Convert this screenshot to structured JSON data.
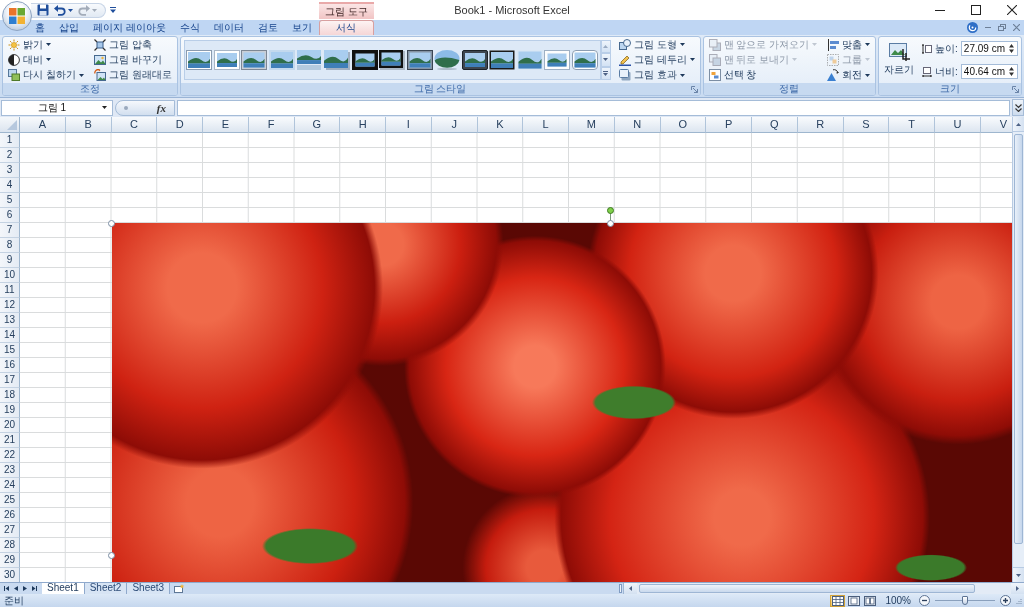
{
  "window": {
    "title": "Book1 - Microsoft Excel",
    "contextual_group": "그림 도구"
  },
  "quick_access": [
    {
      "kind": "save",
      "disabled": false,
      "dropdown": false
    },
    {
      "kind": "undo",
      "disabled": false,
      "dropdown": true
    },
    {
      "kind": "redo",
      "disabled": true,
      "dropdown": true
    }
  ],
  "tabs": [
    {
      "label": "홈",
      "selected": false,
      "contextual": false
    },
    {
      "label": "삽입",
      "selected": false,
      "contextual": false
    },
    {
      "label": "페이지 레이아웃",
      "selected": false,
      "contextual": false
    },
    {
      "label": "수식",
      "selected": false,
      "contextual": false
    },
    {
      "label": "데이터",
      "selected": false,
      "contextual": false
    },
    {
      "label": "검토",
      "selected": false,
      "contextual": false
    },
    {
      "label": "보기",
      "selected": false,
      "contextual": false
    },
    {
      "label": "서식",
      "selected": true,
      "contextual": true
    }
  ],
  "ribbon_groups": [
    {
      "kind": "adjust",
      "label": "조정",
      "launcher": false,
      "columns": [
        [
          {
            "label": "밝기",
            "dropdown": true,
            "disabled": false
          },
          {
            "label": "대비",
            "dropdown": true,
            "disabled": false
          },
          {
            "label": "다시 칠하기",
            "dropdown": true,
            "disabled": false
          }
        ],
        [
          {
            "label": "그림 압축",
            "dropdown": false,
            "disabled": false
          },
          {
            "label": "그림 바꾸기",
            "dropdown": false,
            "disabled": false
          },
          {
            "label": "그림 원래대로",
            "dropdown": false,
            "disabled": false
          }
        ]
      ]
    },
    {
      "kind": "styles",
      "label": "그림 스타일",
      "launcher": true,
      "columns": [
        [
          {
            "label": "그림 도형",
            "dropdown": true,
            "disabled": false
          },
          {
            "label": "그림 테두리",
            "dropdown": true,
            "disabled": false
          },
          {
            "label": "그림 효과",
            "dropdown": true,
            "disabled": false
          }
        ]
      ]
    },
    {
      "kind": "arrange",
      "label": "정렬",
      "launcher": false,
      "columns": [
        [
          {
            "label": "맨 앞으로 가져오기",
            "dropdown": true,
            "disabled": true
          },
          {
            "label": "맨 뒤로 보내기",
            "dropdown": true,
            "disabled": true
          },
          {
            "label": "선택 창",
            "dropdown": false,
            "disabled": false
          }
        ],
        [
          {
            "label": "맞춤",
            "dropdown": true,
            "disabled": false
          },
          {
            "label": "그룹",
            "dropdown": true,
            "disabled": true
          },
          {
            "label": "회전",
            "dropdown": true,
            "disabled": false
          }
        ]
      ]
    },
    {
      "kind": "size",
      "label": "크기",
      "launcher": true,
      "crop": {
        "label": "자르기"
      },
      "fields": [
        {
          "label": "높이:",
          "value": "27.09 cm"
        },
        {
          "label": "너비:",
          "value": "40.64 cm"
        }
      ]
    }
  ],
  "formula_bar": {
    "name_box": "그림 1",
    "function_label": "fx"
  },
  "sheet": {
    "columns": [
      "A",
      "B",
      "C",
      "D",
      "E",
      "F",
      "G",
      "H",
      "I",
      "J",
      "K",
      "L",
      "M",
      "N",
      "O",
      "P",
      "Q",
      "R",
      "S",
      "T",
      "U",
      "V"
    ],
    "rows": [
      "1",
      "2",
      "3",
      "4",
      "5",
      "6",
      "7",
      "8",
      "9",
      "10",
      "11",
      "12",
      "13",
      "14",
      "15",
      "16",
      "17",
      "18",
      "19",
      "20",
      "21",
      "22",
      "23",
      "24",
      "25",
      "26",
      "27",
      "28",
      "29",
      "30"
    ],
    "picture": {
      "selected": true
    }
  },
  "sheet_tabs": [
    {
      "label": "Sheet1",
      "selected": true
    },
    {
      "label": "Sheet2",
      "selected": false
    },
    {
      "label": "Sheet3",
      "selected": false
    }
  ],
  "status_bar": {
    "text": "준비",
    "view_buttons": [
      {
        "kind": "normal",
        "selected": true
      },
      {
        "kind": "page_layout",
        "selected": false
      },
      {
        "kind": "page_break",
        "selected": false
      }
    ],
    "zoom": "100%",
    "zoom_slider": {
      "level": 0.5
    }
  }
}
